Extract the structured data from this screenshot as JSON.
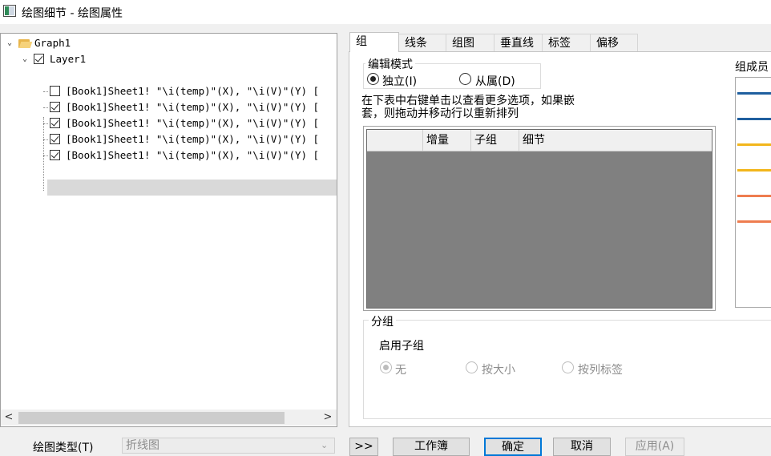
{
  "window": {
    "title": "绘图细节 - 绘图属性"
  },
  "tree": {
    "root": {
      "label": "Graph1"
    },
    "layer": {
      "label": "Layer1",
      "checked": true
    },
    "datasets": [
      {
        "label": "[Book1]Sheet1! \"\\i(temp)\"(X), \"\\i(V)\"(Y) [",
        "checked": false,
        "selected": false
      },
      {
        "label": "[Book1]Sheet1! \"\\i(temp)\"(X), \"\\i(V)\"(Y) [",
        "checked": true,
        "selected": false
      },
      {
        "label": "[Book1]Sheet1! \"\\i(temp)\"(X), \"\\i(V)\"(Y) [",
        "checked": true,
        "selected": false
      },
      {
        "label": "[Book1]Sheet1! \"\\i(temp)\"(X), \"\\i(V)\"(Y) [",
        "checked": true,
        "selected": false
      },
      {
        "label": "[Book1]Sheet1! \"\\i(temp)\"(X), \"\\i(V)\"(Y) [",
        "checked": true,
        "selected": true
      }
    ],
    "scroll_left": "<",
    "scroll_right": ">"
  },
  "tabs": [
    {
      "label": "组",
      "active": true
    },
    {
      "label": "线条",
      "active": false
    },
    {
      "label": "组图",
      "active": false
    },
    {
      "label": "垂直线",
      "active": false
    },
    {
      "label": "标签",
      "active": false
    },
    {
      "label": "偏移",
      "active": false
    }
  ],
  "edit_mode": {
    "legend": "编辑模式",
    "options": [
      {
        "label": "独立(I)",
        "selected": true
      },
      {
        "label": "从属(D)",
        "selected": false
      }
    ]
  },
  "hint": "在下表中右键单击以查看更多选项，如果嵌套，则拖动并移动行以重新排列",
  "table": {
    "columns": [
      "",
      "增量",
      "子组",
      "细节"
    ]
  },
  "members": {
    "label": "组成员",
    "line_colors": [
      "#1f5f9f",
      "#1f5f9f",
      "#f2b61c",
      "#f2b61c",
      "#ee7d4f",
      "#ee7d4f"
    ]
  },
  "subgroup": {
    "legend": "分组",
    "enable_label": "启用子组",
    "options": [
      {
        "label": "无",
        "selected": true
      },
      {
        "label": "按大小",
        "selected": false
      },
      {
        "label": "按列标签",
        "selected": false
      }
    ]
  },
  "bottom": {
    "plot_type_label": "绘图类型(T)",
    "plot_type_value": "折线图",
    "expand_button": ">>",
    "workbook_button": "工作簿",
    "ok_button": "确定",
    "cancel_button": "取消",
    "apply_button": "应用(A)"
  }
}
